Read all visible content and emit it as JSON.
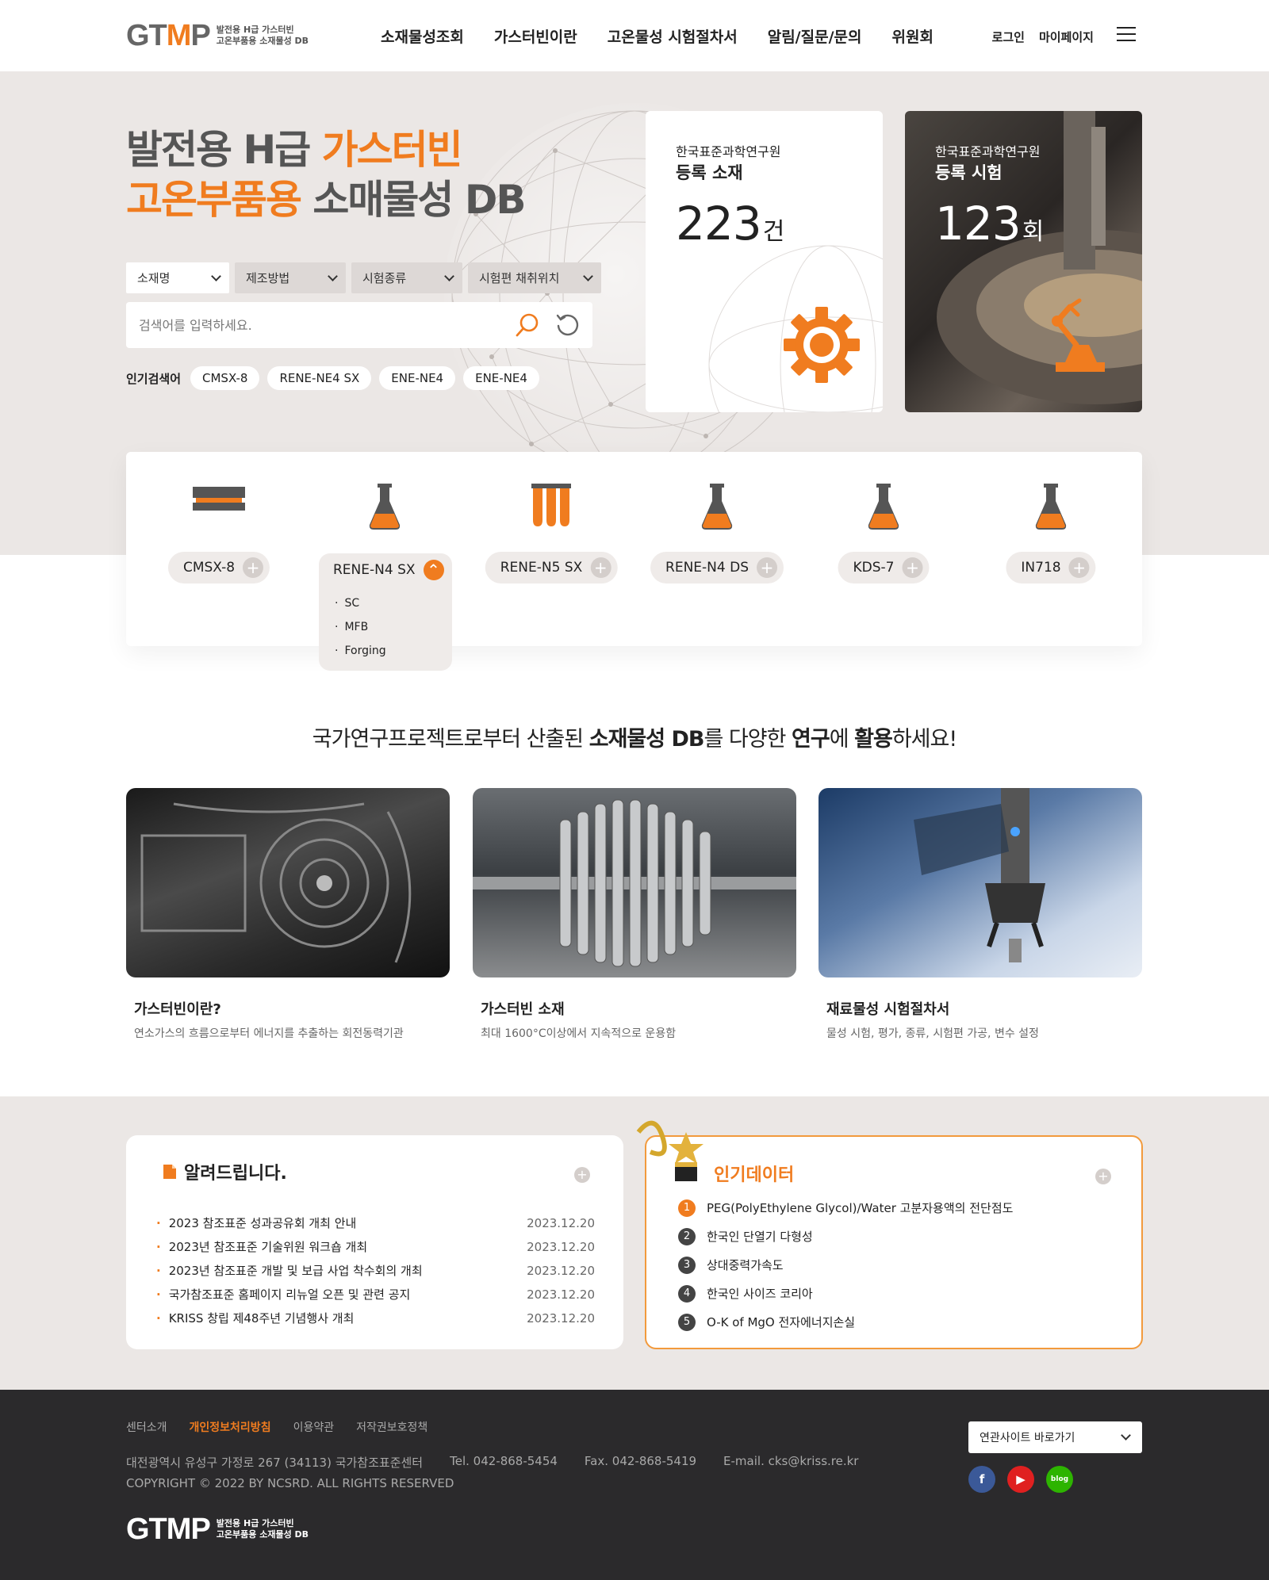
{
  "header": {
    "logo_mark_left": "GT",
    "logo_mark_m": "M",
    "logo_mark_right": "P",
    "logo_sub_line1": "발전용 H급 가스터빈",
    "logo_sub_line2": "고온부품용 소재물성 DB",
    "nav": [
      "소재물성조회",
      "가스터빈이란",
      "고온물성 시험절차서",
      "알림/질문/문의",
      "위원회"
    ],
    "login": "로그인",
    "mypage": "마이페이지",
    "menu_icon": "hamburger-icon"
  },
  "hero": {
    "title_line1_a": "발전용 H급 ",
    "title_line1_b": "가스터빈",
    "title_line2_a": "고온부품용",
    "title_line2_b": " 소매물성 DB",
    "filters": [
      "소재명",
      "제조방법",
      "시험종류",
      "시험편 채취위치"
    ],
    "search_placeholder": "검색어를 입력하세요.",
    "popular_label": "인기검색어",
    "popular_tags": [
      "CMSX-8",
      "RENE-NE4 SX",
      "ENE-NE4",
      "ENE-NE4"
    ]
  },
  "stats": [
    {
      "org": "한국표준과학연구원",
      "title": "등록 소재",
      "number": "223",
      "unit": "건",
      "icon": "gear-icon"
    },
    {
      "org": "한국표준과학연구원",
      "title": "등록 시험",
      "number": "123",
      "unit": "회",
      "icon": "robot-arm-icon"
    }
  ],
  "materials": [
    {
      "name": "CMSX-8",
      "icon": "plate-icon"
    },
    {
      "name": "RENE-N4 SX",
      "icon": "flask-icon",
      "expanded": true,
      "options": [
        "SC",
        "MFB",
        "Forging"
      ]
    },
    {
      "name": "RENE-N5 SX",
      "icon": "test-tubes-icon"
    },
    {
      "name": "RENE-N4 DS",
      "icon": "flask-icon"
    },
    {
      "name": "KDS-7",
      "icon": "flask-icon"
    },
    {
      "name": "IN718",
      "icon": "flask-icon"
    }
  ],
  "slogan": {
    "a": "국가연구프로젝트로부터 산출된 ",
    "b": "소재물성 DB",
    "c": "를 다양한 ",
    "d": "연구",
    "e": "에 ",
    "f": "활용",
    "g": "하세요!"
  },
  "cards": [
    {
      "title": "가스터빈이란?",
      "desc": "연소가스의 흐름으로부터 에너지를 추출하는 회전동력기관"
    },
    {
      "title": "가스터빈 소재",
      "desc": "최대 1600°C이상에서 지속적으로 운용함"
    },
    {
      "title": "재료물성 시험절차서",
      "desc": "물성 시험, 평가, 종류, 시험편 가공, 변수 설정"
    }
  ],
  "notice": {
    "title": "알려드립니다.",
    "items": [
      {
        "title": "2023 참조표준 성과공유회 개최 안내",
        "date": "2023.12.20"
      },
      {
        "title": "2023년 참조표준 기술위원 워크숍 개최",
        "date": "2023.12.20"
      },
      {
        "title": "2023년 참조표준 개발 및 보급 사업 착수회의 개최",
        "date": "2023.12.20"
      },
      {
        "title": "국가참조표준 홈페이지 리뉴얼 오픈 및 관련 공지",
        "date": "2023.12.20"
      },
      {
        "title": "KRISS 창립 제48주년 기념행사 개최",
        "date": "2023.12.20"
      }
    ]
  },
  "popular_data": {
    "title": "인기데이터",
    "items": [
      {
        "rank": "1",
        "title": "PEG(PolyEthylene Glycol)/Water 고분자용액의 전단점도"
      },
      {
        "rank": "2",
        "title": "한국인 단열기 다형성"
      },
      {
        "rank": "3",
        "title": "상대중력가속도"
      },
      {
        "rank": "4",
        "title": "한국인 사이즈 코리아"
      },
      {
        "rank": "5",
        "title": "O-K of MgO 전자에너지손실"
      }
    ]
  },
  "footer": {
    "links": [
      "센터소개",
      "개인정보처리방침",
      "이용약관",
      "저작권보호정책"
    ],
    "address": "대전광역시 유성구 가정로 267 (34113) 국가참조표준센터",
    "tel": "Tel. 042-868-5454",
    "fax": "Fax. 042-868-5419",
    "email": "E-mail. cks@kriss.re.kr",
    "copyright": "COPYRIGHT © 2022 BY NCSRD. ALL RIGHTS RESERVED",
    "related_sites": "연관사이트 바로가기",
    "social": [
      "facebook-icon",
      "youtube-icon",
      "blog-icon"
    ],
    "blog_label": "blog"
  },
  "colors": {
    "accent": "#f07c1f",
    "hero_bg": "#ebe7e5",
    "footer_bg": "#2b2a2c"
  }
}
